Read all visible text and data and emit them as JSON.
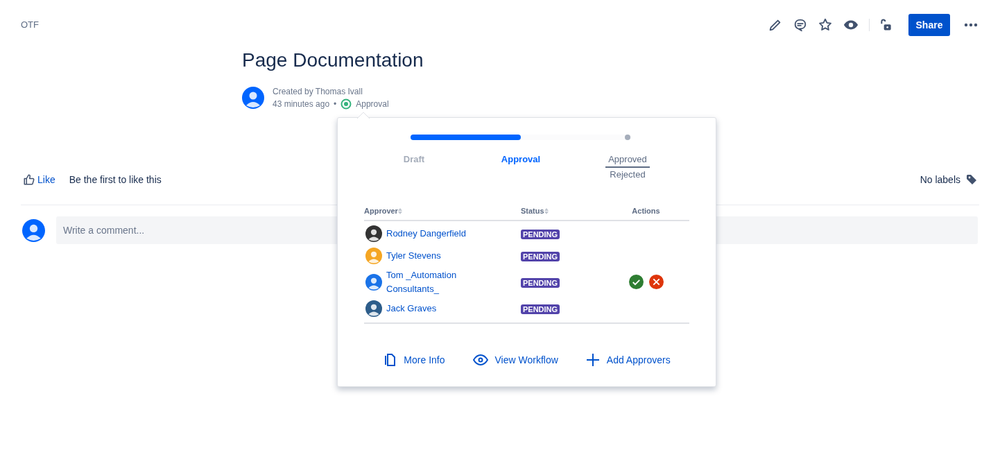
{
  "space": "OTF",
  "toolbar": {
    "share": "Share"
  },
  "page": {
    "title": "Page Documentation",
    "created_by": "Created by Thomas Ivall",
    "time": "43 minutes ago",
    "separator": "•",
    "workflow_state": "Approval"
  },
  "workflow": {
    "level": 0.5,
    "steps": [
      {
        "labels": [
          "Draft"
        ],
        "selected": false
      },
      {
        "labels": [
          "Approval"
        ],
        "selected": true
      },
      {
        "labels": [
          "Approved",
          "Rejected"
        ],
        "selected": false
      }
    ],
    "columns": [
      {
        "label": "Approver",
        "sortable": true
      },
      {
        "label": "Status",
        "sortable": true
      },
      {
        "label": "Actions",
        "sortable": false
      }
    ],
    "rows": [
      {
        "name": "Rodney Dangerfield",
        "status": "PENDING",
        "actions": false,
        "color": "#333333"
      },
      {
        "name": "Tyler Stevens",
        "status": "PENDING",
        "actions": false,
        "color": "#f5a623"
      },
      {
        "name": "Tom _Automation Consultants_",
        "status": "PENDING",
        "actions": true,
        "color": "#1a73e8"
      },
      {
        "name": "Jack Graves",
        "status": "PENDING",
        "actions": false,
        "color": "#2d5d8a"
      }
    ],
    "links": [
      {
        "kind": "info",
        "label": "More Info"
      },
      {
        "kind": "view",
        "label": "View Workflow"
      },
      {
        "kind": "add",
        "label": "Add Approvers"
      }
    ]
  },
  "likes": {
    "like": "Like",
    "text": "Be the first to like this",
    "labels": "No labels"
  },
  "comment": {
    "placeholder": "Write a comment..."
  }
}
